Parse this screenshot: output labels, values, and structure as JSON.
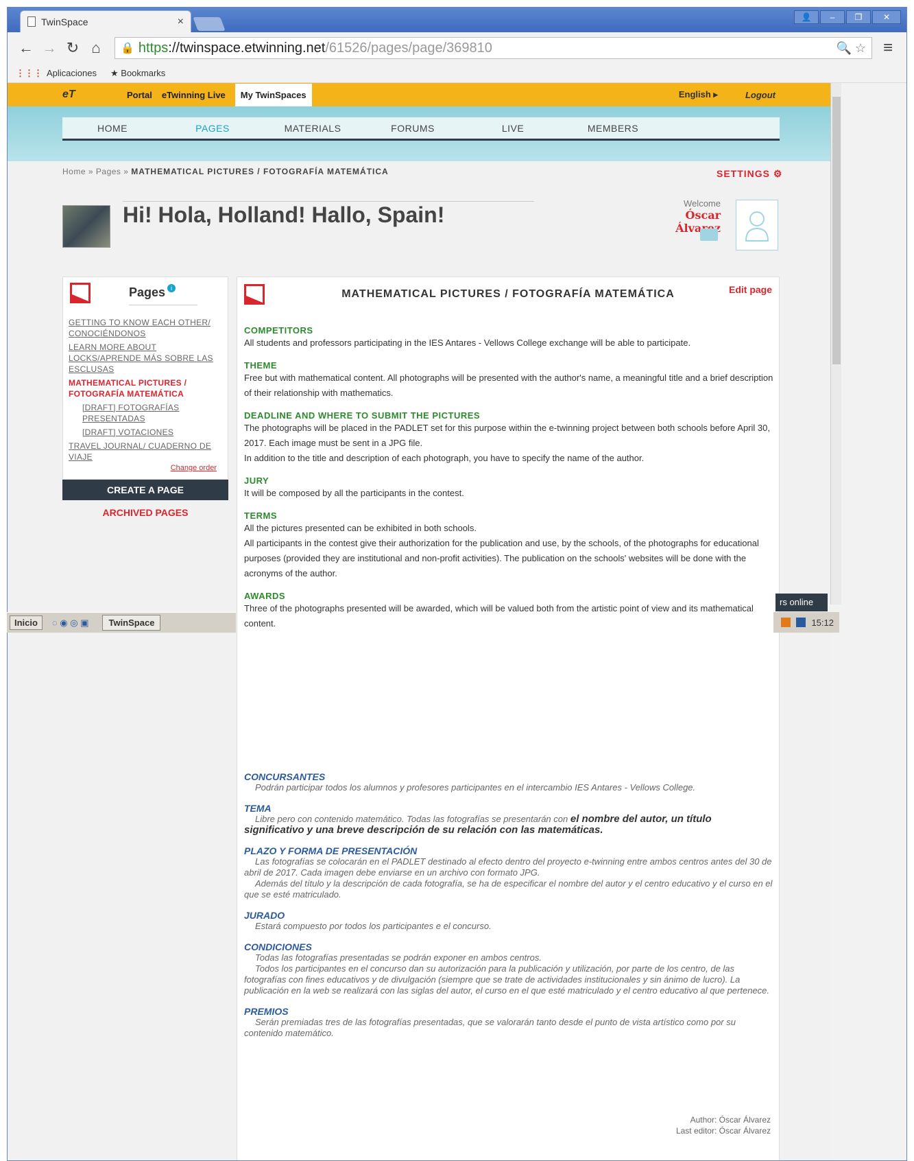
{
  "browser": {
    "tab_title": "TwinSpace",
    "tab_close": "×",
    "url_scheme": "https",
    "url_host": "://twinspace.etwinning.net",
    "url_path": "/61526/pages/page/369810",
    "bookmarks": [
      "Aplicaciones",
      "Bookmarks"
    ]
  },
  "topbar": {
    "links": [
      "Portal",
      "eTwinning Live",
      "My TwinSpaces"
    ],
    "english": "English ▸",
    "logout": "Logout"
  },
  "nav": {
    "items": [
      "HOME",
      "PAGES",
      "MATERIALS",
      "FORUMS",
      "LIVE",
      "MEMBERS"
    ],
    "active": "PAGES"
  },
  "breadcrumb": {
    "home": "Home",
    "sep": "»",
    "pages": "Pages",
    "current": "MATHEMATICAL PICTURES / FOTOGRAFÍA MATEMÁTICA"
  },
  "settings_label": "SETTINGS",
  "space_title": "Hi! Hola, Holland! Hallo, Spain!",
  "welcome": {
    "label": "Welcome",
    "user": "Óscar Álvarez"
  },
  "sidebar": {
    "title": "Pages",
    "items": [
      {
        "label": "GETTING TO KNOW EACH OTHER/ CONOCIÉNDONOS"
      },
      {
        "label": "LEARN MORE ABOUT LOCKS/APRENDE MÁS SOBRE LAS ESCLUSAS"
      },
      {
        "label": "MATHEMATICAL PICTURES / FOTOGRAFÍA MATEMÁTICA"
      },
      {
        "label": "[DRAFT] FOTOGRAFÍAS PRESENTADAS"
      },
      {
        "label": "[DRAFT] VOTACIONES"
      },
      {
        "label": "TRAVEL JOURNAL/ CUADERNO DE VIAJE"
      }
    ],
    "change_order": "Change order",
    "create_page": "CREATE A PAGE",
    "archived_pages": "ARCHIVED PAGES"
  },
  "content": {
    "title": "MATHEMATICAL PICTURES / FOTOGRAFÍA MATEMÁTICA",
    "edit_page": "Edit page",
    "sections": [
      {
        "h": "COMPETITORS",
        "p": "All students and professors participating in the IES Antares - Vellows College exchange will be able to participate."
      },
      {
        "h": "THEME",
        "p": "Free but with mathematical content. All photographs will be presented with the author's name, a meaningful title and a brief description of their relationship with mathematics."
      },
      {
        "h": "DEADLINE AND WHERE TO SUBMIT THE PICTURES",
        "p": "The photographs will be placed in the PADLET set for this purpose within the e-twinning project between both schools before April 30, 2017. Each image must be sent in a JPG file.",
        "p2": "In addition to the title and description of each photograph, you have to specify the name of the author."
      },
      {
        "h": "JURY",
        "p": "It will be composed by all the participants in the contest."
      },
      {
        "h": "TERMS",
        "p": "All the pictures presented can be exhibited in both schools.",
        "p2": "All participants in the contest give their authorization for the publication and use, by the schools, of the photographs for educational purposes (provided they are institutional and non-profit activities). The publication on the schools' websites will be done with the acronyms of the author."
      },
      {
        "h": "AWARDS",
        "p": "Three of the photographs presented will be awarded, which will be valued both from the artistic point of view and its mathematical content."
      }
    ],
    "es_sections": [
      {
        "h": "CONCURSANTES",
        "p": "Podrán participar todos los alumnos y profesores participantes en el intercambio IES Antares - Vellows College."
      },
      {
        "h": "TEMA",
        "p": "Libre pero con contenido matemático. Todas las fotografías se presentarán con",
        "b": "el nombre del autor, un título significativo y una breve descripción de su relación con las matemáticas."
      },
      {
        "h": "PLAZO Y FORMA DE PRESENTACIÓN",
        "p": "Las fotografías se colocarán en el PADLET destinado al efecto dentro del proyecto e-twinning entre ambos centros antes del 30 de abril de 2017. Cada imagen debe enviarse en un archivo con formato JPG.",
        "p2": "Además del título y la descripción de cada fotografía, se ha de especificar el nombre del autor y el centro educativo y el curso en el que se esté matriculado."
      },
      {
        "h": "JURADO",
        "p": "Estará compuesto por todos los participantes e el concurso."
      },
      {
        "h": "CONDICIONES",
        "p": "Todas las fotografías presentadas se podrán exponer en ambos centros.",
        "p2": "Todos los participantes en el concurso dan su autorización para la publicación y utilización, por parte de los centro, de las fotografías con fines educativos y de divulgación (siempre que se trate de actividades institucionales y sin ánimo de lucro). La publicación en la web se realizará con las siglas del autor, el curso en el que esté matriculado y el centro educativo al que pertenece."
      },
      {
        "h": "PREMIOS",
        "p": "Serán premiadas tres de las fotografías presentadas, que se valorarán tanto desde el punto de vista artístico como por su contenido matemático."
      }
    ],
    "author": "Author: Óscar Álvarez",
    "last_editor": "Last editor: Óscar Álvarez"
  },
  "users_online": "rs online",
  "taskbar": {
    "start": "Inicio",
    "task": "TwinSpace",
    "clock": "15:12"
  }
}
